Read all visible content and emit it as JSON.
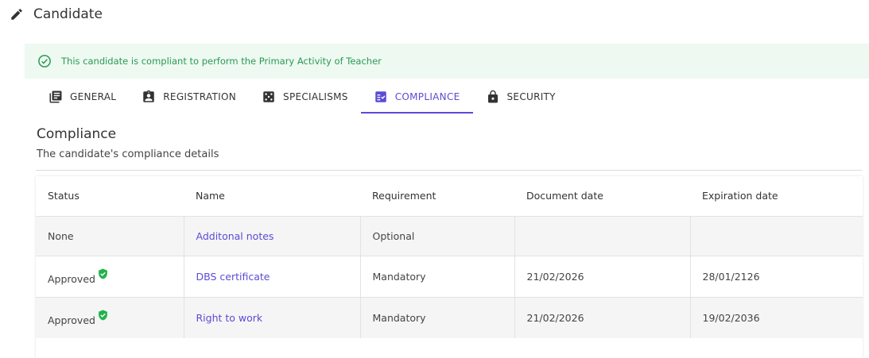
{
  "header": {
    "title": "Candidate",
    "icon": "pencil-icon"
  },
  "alert": {
    "message": "This candidate is compliant to perform the Primary Activity of Teacher",
    "icon": "check-circle-icon",
    "color": "#2a9a55",
    "background": "#eef9f1"
  },
  "tabs": [
    {
      "label": "GENERAL",
      "icon": "document-list-icon"
    },
    {
      "label": "REGISTRATION",
      "icon": "id-badge-icon"
    },
    {
      "label": "SPECIALISMS",
      "icon": "dice-icon"
    },
    {
      "label": "COMPLIANCE",
      "icon": "checklist-icon",
      "active": true
    },
    {
      "label": "SECURITY",
      "icon": "lock-icon"
    }
  ],
  "accent_color": "#5b4bd6",
  "section": {
    "title": "Compliance",
    "subtitle": "The candidate's compliance details"
  },
  "table": {
    "columns": [
      "Status",
      "Name",
      "Requirement",
      "Document date",
      "Expiration date"
    ],
    "rows": [
      {
        "status": "None",
        "verified": false,
        "name": "Additonal notes",
        "requirement": "Optional",
        "document_date": "",
        "expiration_date": ""
      },
      {
        "status": "Approved",
        "verified": true,
        "name": "DBS certificate",
        "requirement": "Mandatory",
        "document_date": "21/02/2026",
        "expiration_date": "28/01/2126"
      },
      {
        "status": "Approved",
        "verified": true,
        "name": "Right to work",
        "requirement": "Mandatory",
        "document_date": "21/02/2026",
        "expiration_date": "19/02/2036"
      }
    ]
  },
  "verified_color": "#22b34c"
}
